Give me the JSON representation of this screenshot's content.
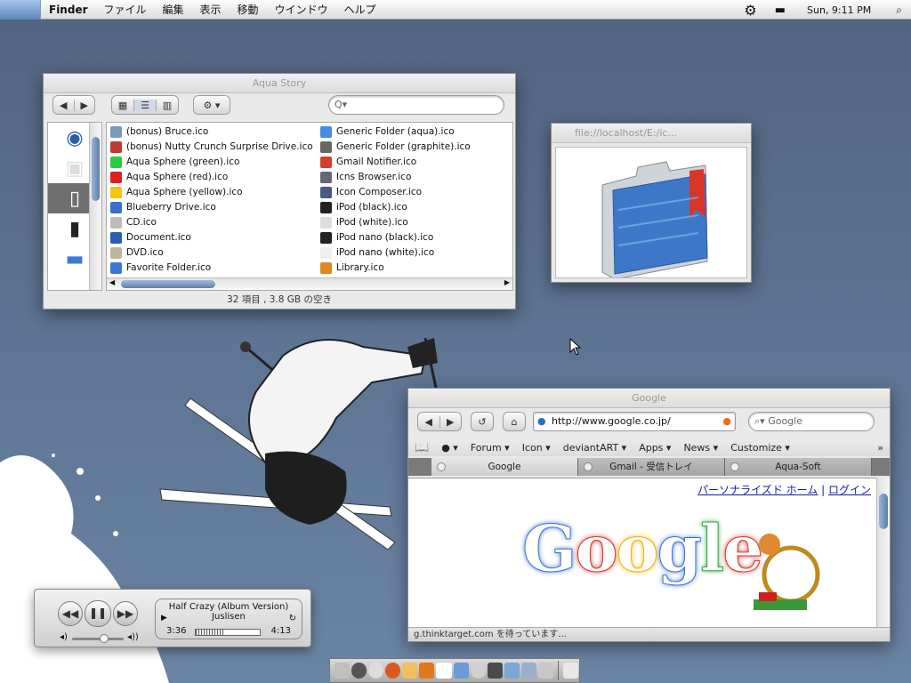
{
  "menubar": {
    "items": [
      "Finder",
      "ファイル",
      "編集",
      "表示",
      "移動",
      "ウインドウ",
      "ヘルプ"
    ],
    "clock": "Sun, 9:11 PM",
    "icons": [
      "gear-icon",
      "display-icon",
      "spotlight-icon"
    ]
  },
  "finder": {
    "title": "Aqua Story",
    "search_placeholder": "Q▾",
    "status": "32 項目 , 3.8 GB の空き",
    "files_col1": [
      "(bonus) Bruce.ico",
      "(bonus) Nutty Crunch Surprise Drive.ico",
      "Aqua Sphere (green).ico",
      "Aqua Sphere (red).ico",
      "Aqua Sphere (yellow).ico",
      "Blueberry Drive.ico",
      "CD.ico",
      "Document.ico",
      "DVD.ico",
      "Favorite Folder.ico"
    ],
    "files_col2": [
      "Generic Folder (aqua).ico",
      "Generic Folder (graphite).ico",
      "Gmail Notifier.ico",
      "Icns Browser.ico",
      "Icon Composer.ico",
      "iPod (black).ico",
      "iPod (white).ico",
      "iPod nano (black).ico",
      "iPod nano (white).ico",
      "Library.ico"
    ],
    "icon_colors_col1": [
      "#7a9ab8",
      "#c0392b",
      "#2ecc40",
      "#e02020",
      "#f1c40f",
      "#3a6ec8",
      "#bbbbbb",
      "#2a5bb8",
      "#b8b8a0",
      "#3b78d8"
    ],
    "icon_colors_col2": [
      "#4a8be0",
      "#666666",
      "#d04030",
      "#666677",
      "#4a5a80",
      "#222222",
      "#dddddd",
      "#222222",
      "#eeeeee",
      "#d88a20"
    ]
  },
  "preview": {
    "title": "file://localhost/E:/ic..."
  },
  "browser": {
    "title": "Google",
    "url": "http://www.google.co.jp/",
    "search_placeholder": "Google",
    "bookmarks": [
      "Forum ▾",
      "Icon ▾",
      "deviantART ▾",
      "Apps ▾",
      "News ▾",
      "Customize ▾"
    ],
    "tabs": [
      "Google",
      "Gmail - 受信トレイ",
      "Aqua-Soft"
    ],
    "personal_home": "パーソナライズド ホーム",
    "separator": "|",
    "login": "ログイン",
    "logo": "Google",
    "status": "g.thinktarget.com を待っています..."
  },
  "player": {
    "track": "Half Crazy (Album Version)",
    "artist": "Juslisen",
    "elapsed": "3:36",
    "remaining": "4:13",
    "progress": 0.46,
    "volume": 0.6
  }
}
